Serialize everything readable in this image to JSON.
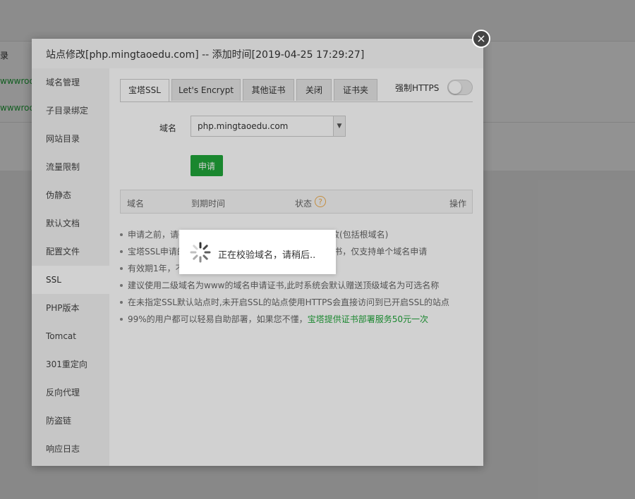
{
  "background": {
    "rows": [
      {
        "text": "录",
        "color": "#333333"
      },
      {
        "text": "wwwroot",
        "color": "#20a53a"
      },
      {
        "text": "wwwroot",
        "color": "#20a53a"
      }
    ]
  },
  "modal": {
    "title": "站点修改[php.mingtaoedu.com] -- 添加时间[2019-04-25 17:29:27]",
    "close_label": "×"
  },
  "sidebar": {
    "items": [
      {
        "label": "域名管理"
      },
      {
        "label": "子目录绑定"
      },
      {
        "label": "网站目录"
      },
      {
        "label": "流量限制"
      },
      {
        "label": "伪静态"
      },
      {
        "label": "默认文档"
      },
      {
        "label": "配置文件"
      },
      {
        "label": "SSL",
        "active": true
      },
      {
        "label": "PHP版本"
      },
      {
        "label": "Tomcat"
      },
      {
        "label": "301重定向"
      },
      {
        "label": "反向代理"
      },
      {
        "label": "防盗链"
      },
      {
        "label": "响应日志"
      }
    ]
  },
  "ssl": {
    "tabs": [
      {
        "label": "宝塔SSL",
        "active": true
      },
      {
        "label": "Let's Encrypt"
      },
      {
        "label": "其他证书"
      },
      {
        "label": "关闭"
      },
      {
        "label": "证书夹"
      }
    ],
    "force_https_label": "强制HTTPS",
    "force_https_enabled": false,
    "domain_label": "域名",
    "domain_value": "php.mingtaoedu.com",
    "apply_label": "申请",
    "table_headers": [
      "域名",
      "到期时间",
      "状态",
      "操作"
    ],
    "notes": [
      {
        "text": "申请之前，请确保域名已解析，如未解析会导致审核失败(包括根域名)"
      },
      {
        "text": "宝塔SSL申请的是免费版TrustAsia DV SSL CA - G5证书，仅支持单个域名申请"
      },
      {
        "text": "有效期1年，不支持续签，到期后需要重新申请"
      },
      {
        "text": "建议使用二级域名为www的域名申请证书,此时系统会默认赠送顶级域名为可选名称"
      },
      {
        "text": "在未指定SSL默认站点时,未开启SSL的站点使用HTTPS会直接访问到已开启SSL的站点"
      },
      {
        "text": "99%的用户都可以轻易自助部署，如果您不懂，",
        "link": "宝塔提供证书部署服务50元一次"
      }
    ]
  },
  "loading": {
    "text": "正在校验域名，请稍后.."
  },
  "colors": {
    "accent": "#20a53a",
    "warning": "#f0ad4e"
  }
}
